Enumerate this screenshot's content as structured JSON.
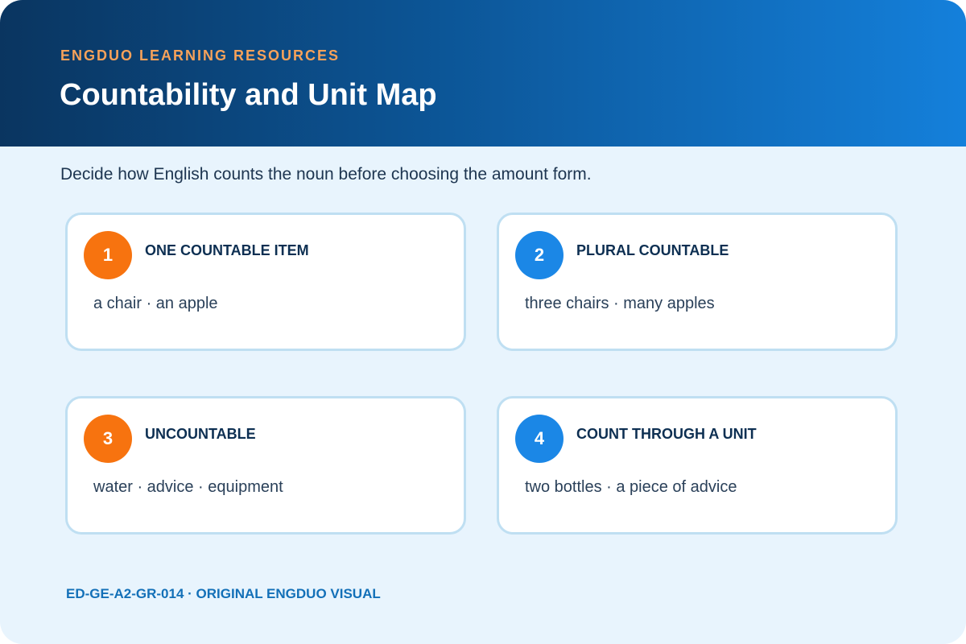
{
  "header": {
    "eyebrow": "ENGDUO LEARNING RESOURCES",
    "title": "Countability and Unit Map"
  },
  "intro": "Decide how English counts the noun before choosing the amount form.",
  "cards": [
    {
      "number": "1",
      "title": "ONE COUNTABLE ITEM",
      "examples": "a chair · an apple",
      "badge_color": "#f7730f"
    },
    {
      "number": "2",
      "title": "PLURAL COUNTABLE",
      "examples": "three chairs · many apples",
      "badge_color": "#1b87e6"
    },
    {
      "number": "3",
      "title": "UNCOUNTABLE",
      "examples": "water · advice · equipment",
      "badge_color": "#f7730f"
    },
    {
      "number": "4",
      "title": "COUNT THROUGH A UNIT",
      "examples": "two bottles · a piece of advice",
      "badge_color": "#1b87e6"
    }
  ],
  "footer": "ED-GE-A2-GR-014 · ORIGINAL ENGDUO VISUAL",
  "colors": {
    "accent_orange": "#f7730f",
    "accent_blue": "#1b87e6",
    "eyebrow": "#f7a25a",
    "background": "#e8f4fd"
  }
}
